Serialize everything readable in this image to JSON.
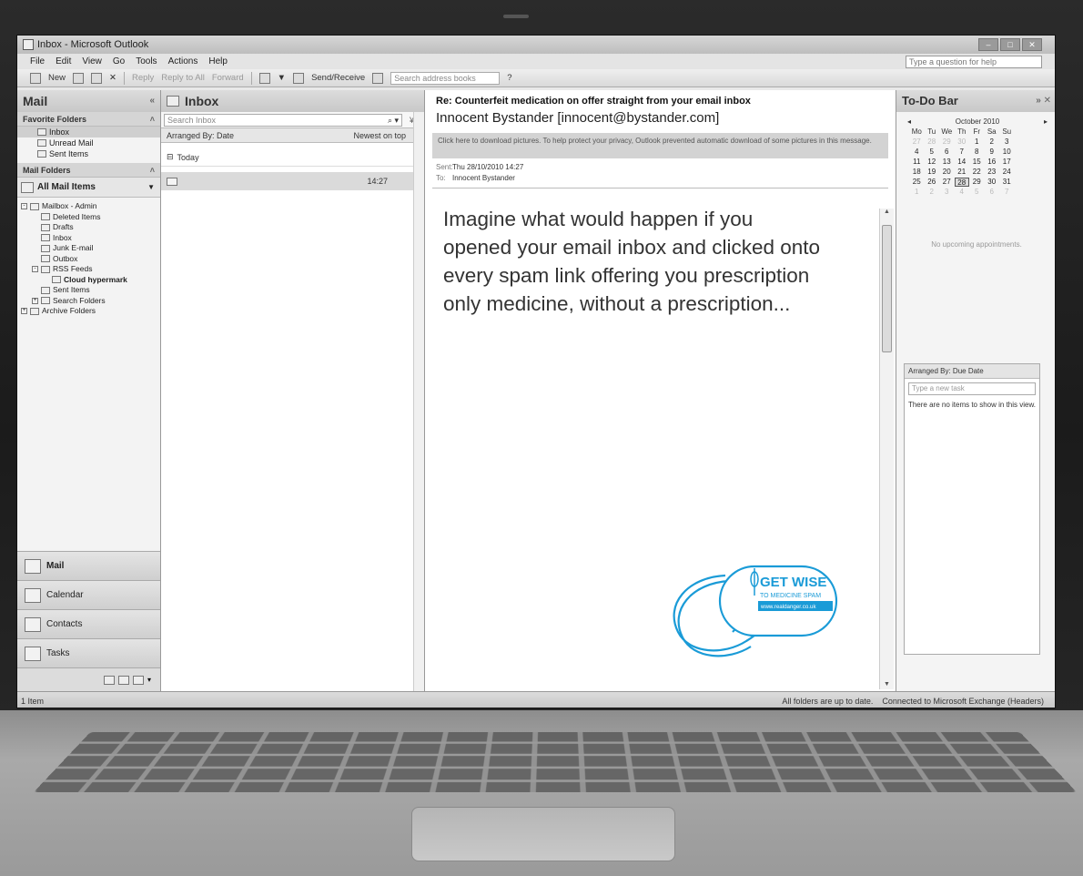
{
  "window": {
    "title": "Inbox - Microsoft Outlook",
    "help_placeholder": "Type a question for help"
  },
  "menu": [
    "File",
    "Edit",
    "View",
    "Go",
    "Tools",
    "Actions",
    "Help"
  ],
  "toolbar": {
    "new": "New",
    "reply": "Reply",
    "reply_all": "Reply to All",
    "forward": "Forward",
    "send_receive": "Send/Receive",
    "address_placeholder": "Search address books"
  },
  "nav": {
    "header": "Mail",
    "favorites_header": "Favorite Folders",
    "favorites": [
      "Inbox",
      "Unread Mail",
      "Sent Items"
    ],
    "folders_header": "Mail Folders",
    "all_mail": "All Mail Items",
    "tree": [
      "Mailbox - Admin",
      "Deleted Items",
      "Drafts",
      "Inbox",
      "Junk E-mail",
      "Outbox",
      "RSS Feeds",
      "Cloud hypermark",
      "Sent Items",
      "Search Folders",
      "Archive Folders"
    ],
    "buttons": [
      "Mail",
      "Calendar",
      "Contacts",
      "Tasks"
    ]
  },
  "list": {
    "header": "Inbox",
    "search_placeholder": "Search Inbox",
    "arranged_by": "Arranged By: Date",
    "order": "Newest on top",
    "group": "Today",
    "message_time": "14:27"
  },
  "reader": {
    "subject": "Re: Counterfeit medication on offer straight from your email inbox",
    "from": "Innocent Bystander [innocent@bystander.com]",
    "infobar": "Click here to download pictures. To help protect your privacy, Outlook prevented automatic download of some pictures in this message.",
    "sent_label": "Sent:",
    "sent_value": "Thu 28/10/2010 14:27",
    "to_label": "To:",
    "to_value": "Innocent Bystander",
    "body": "Imagine what would happen if you opened your email inbox and clicked onto every spam link offering you prescription only medicine, without a prescription...",
    "logo": {
      "line1": "GET WISE",
      "line2": "TO MEDICINE SPAM",
      "url": "www.realdanger.co.uk",
      "color": "#1a9bd7"
    }
  },
  "todo": {
    "header": "To-Do Bar",
    "month": "October 2010",
    "weekdays": [
      "Mo",
      "Tu",
      "We",
      "Th",
      "Fr",
      "Sa",
      "Su"
    ],
    "weeks": [
      [
        "27",
        "28",
        "29",
        "30",
        "1",
        "2",
        "3"
      ],
      [
        "4",
        "5",
        "6",
        "7",
        "8",
        "9",
        "10"
      ],
      [
        "11",
        "12",
        "13",
        "14",
        "15",
        "16",
        "17"
      ],
      [
        "18",
        "19",
        "20",
        "21",
        "22",
        "23",
        "24"
      ],
      [
        "25",
        "26",
        "27",
        "28",
        "29",
        "30",
        "31"
      ],
      [
        "1",
        "2",
        "3",
        "4",
        "5",
        "6",
        "7"
      ]
    ],
    "today": "28",
    "no_appointments": "No upcoming appointments.",
    "tasks_arranged": "Arranged By: Due Date",
    "new_task_placeholder": "Type a new task",
    "no_tasks": "There are no items to show in this view."
  },
  "status": {
    "items": "1 Item",
    "sync": "All folders are up to date.",
    "connection": "Connected to Microsoft Exchange (Headers)"
  }
}
